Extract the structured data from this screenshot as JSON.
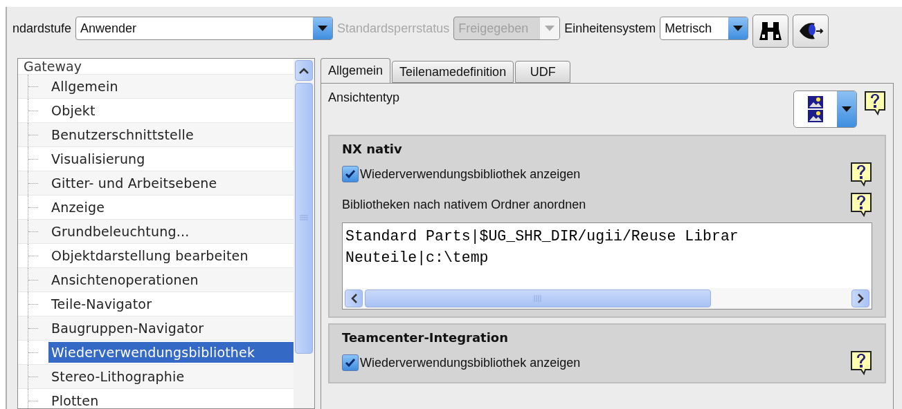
{
  "toolbar": {
    "level_label": "ndardstufe",
    "level_value": "Anwender",
    "lock_label": "Standardsperrstatus",
    "lock_value": "Freigegeben",
    "lock_disabled": true,
    "units_label": "Einheitensystem",
    "units_value": "Metrisch"
  },
  "tree": {
    "label": "Gateway",
    "children": [
      {
        "label": "Allgemein",
        "selected": false
      },
      {
        "label": "Objekt",
        "selected": false
      },
      {
        "label": "Benutzerschnittstelle",
        "selected": false
      },
      {
        "label": "Visualisierung",
        "selected": false
      },
      {
        "label": "Gitter- und Arbeitsebene",
        "selected": false
      },
      {
        "label": "Anzeige",
        "selected": false
      },
      {
        "label": "Grundbeleuchtung...",
        "selected": false
      },
      {
        "label": "Objektdarstellung bearbeiten",
        "selected": false
      },
      {
        "label": "Ansichtenoperationen",
        "selected": false
      },
      {
        "label": "Teile-Navigator",
        "selected": false
      },
      {
        "label": "Baugruppen-Navigator",
        "selected": false
      },
      {
        "label": "Wiederverwendungsbibliothek",
        "selected": true
      },
      {
        "label": "Stereo-Lithographie",
        "selected": false
      },
      {
        "label": "Plotten",
        "selected": false
      }
    ]
  },
  "tabs": [
    {
      "label": "Allgemein",
      "selected": true
    },
    {
      "label": "Teilenamedefinition",
      "selected": false
    },
    {
      "label": "UDF",
      "selected": false
    }
  ],
  "view_type": {
    "label": "Ansichtentyp"
  },
  "sections": [
    {
      "title": "NX nativ",
      "items": [
        {
          "kind": "checkbox",
          "label": "Wiederverwendungsbibliothek anzeigen",
          "checked": true
        },
        {
          "kind": "list",
          "label": "Bibliotheken nach nativem Ordner anordnen",
          "lines": [
            "Standard Parts|$UG_SHR_DIR/ugii/Reuse Librar",
            "Neuteile|c:\\temp"
          ]
        }
      ]
    },
    {
      "title": "Teamcenter-Integration",
      "items": [
        {
          "kind": "checkbox",
          "label": "Wiederverwendungsbibliothek anzeigen",
          "checked": true
        }
      ]
    }
  ]
}
